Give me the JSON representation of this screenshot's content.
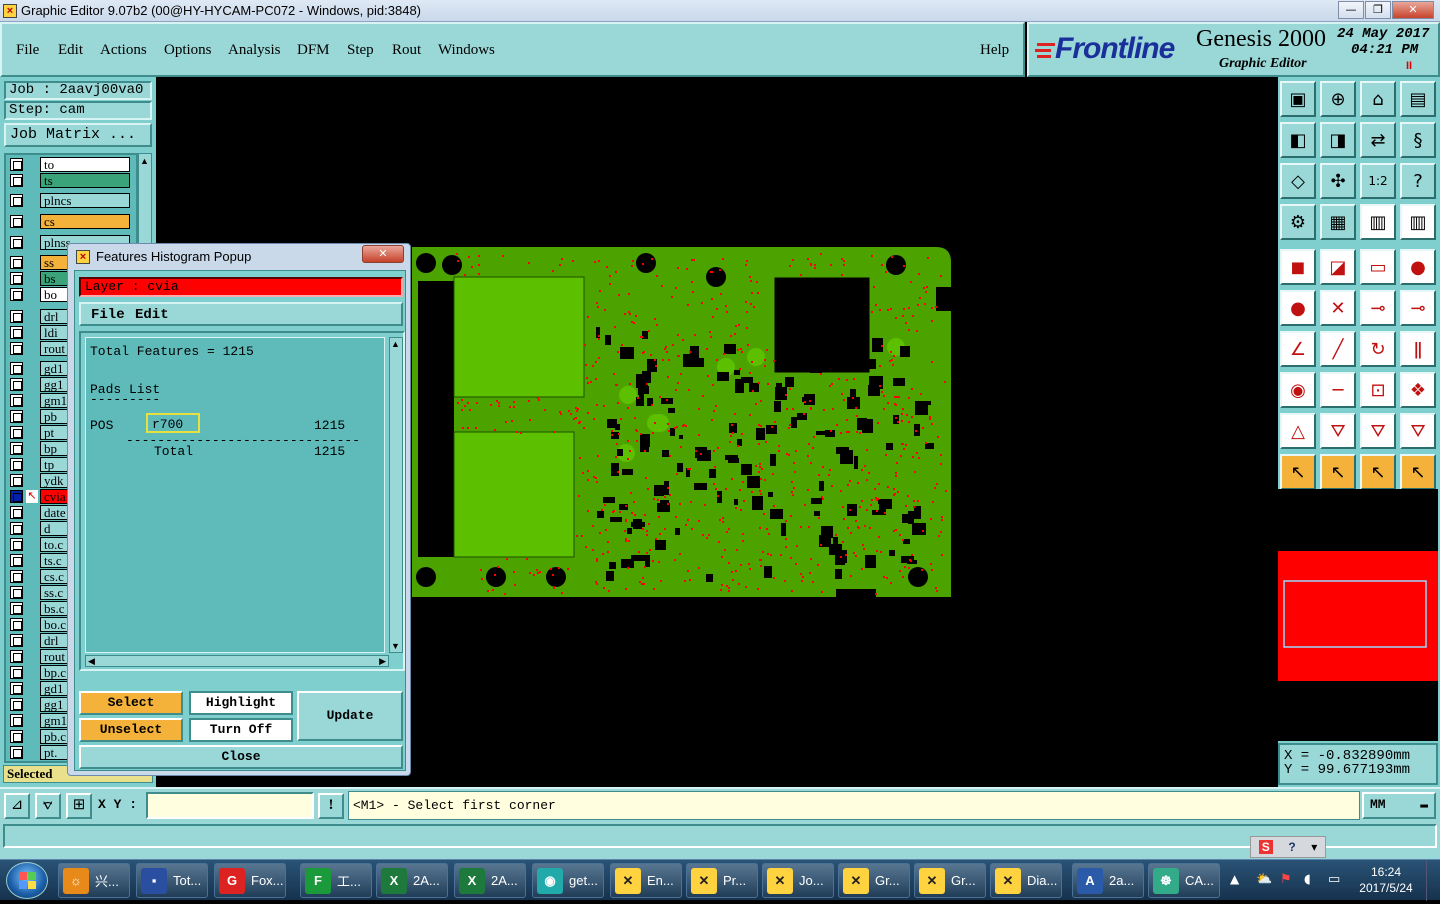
{
  "window": {
    "title": "Graphic Editor 9.07b2 (00@HY-HYCAM-PC072 - Windows, pid:3848)",
    "min": "—",
    "max": "❐",
    "close": "✕"
  },
  "menu": {
    "items": [
      "File",
      "Edit",
      "Actions",
      "Options",
      "Analysis",
      "DFM",
      "Step",
      "Rout",
      "Windows"
    ],
    "help": "Help"
  },
  "brand": {
    "logo": "Frontline",
    "product": "Genesis 2000",
    "subtitle": "Graphic Editor",
    "date": "24 May 2017",
    "time": "04:21 PM",
    "indicator": "II"
  },
  "job": {
    "job_label": "Job : 2aavj00va0",
    "step_label": "Step: cam",
    "matrix_label": "Job Matrix ..."
  },
  "layers": [
    {
      "name": "to",
      "color": "#ffffff"
    },
    {
      "name": "ts",
      "color": "#3aa37a"
    },
    {
      "name": "plncs",
      "color": "#9ad8d8"
    },
    {
      "name": "cs",
      "color": "#f4b23a"
    },
    {
      "name": "plnss",
      "color": "#9ad8d8"
    },
    {
      "name": "ss",
      "color": "#f4b23a"
    },
    {
      "name": "bs",
      "color": "#3aa37a"
    },
    {
      "name": "bo",
      "color": "#ffffff"
    },
    {
      "name": "drl",
      "color": "#9ad8d8"
    },
    {
      "name": "ldi",
      "color": "#9ad8d8"
    },
    {
      "name": "rout",
      "color": "#9ad8d8"
    },
    {
      "name": "gd1",
      "color": "#9ad8d8"
    },
    {
      "name": "gg1",
      "color": "#9ad8d8"
    },
    {
      "name": "gm1",
      "color": "#9ad8d8"
    },
    {
      "name": "pb",
      "color": "#9ad8d8"
    },
    {
      "name": "pt",
      "color": "#9ad8d8"
    },
    {
      "name": "bp",
      "color": "#9ad8d8"
    },
    {
      "name": "tp",
      "color": "#9ad8d8"
    },
    {
      "name": "ydk",
      "color": "#9ad8d8"
    },
    {
      "name": "cvia",
      "color": "#ff0000"
    },
    {
      "name": "date",
      "color": "#9ad8d8"
    },
    {
      "name": "d",
      "color": "#9ad8d8"
    },
    {
      "name": "to.c",
      "color": "#9ad8d8"
    },
    {
      "name": "ts.c",
      "color": "#9ad8d8"
    },
    {
      "name": "cs.c",
      "color": "#9ad8d8"
    },
    {
      "name": "ss.c",
      "color": "#9ad8d8"
    },
    {
      "name": "bs.c",
      "color": "#9ad8d8"
    },
    {
      "name": "bo.c",
      "color": "#9ad8d8"
    },
    {
      "name": "drl",
      "color": "#9ad8d8"
    },
    {
      "name": "rout",
      "color": "#9ad8d8"
    },
    {
      "name": "bp.c",
      "color": "#9ad8d8"
    },
    {
      "name": "gd1",
      "color": "#9ad8d8"
    },
    {
      "name": "gg1",
      "color": "#9ad8d8"
    },
    {
      "name": "gm1",
      "color": "#9ad8d8"
    },
    {
      "name": "pb.c",
      "color": "#9ad8d8"
    },
    {
      "name": "pt.",
      "color": "#9ad8d8"
    }
  ],
  "selected_label": "Selected",
  "popup": {
    "title": "Features Histogram Popup",
    "close": "✕",
    "layer_label": "Layer : cvia",
    "menu": [
      "File",
      "Edit"
    ],
    "total_features": "Total Features = 1215",
    "pads_heading": "Pads List",
    "pads_underline": "---------",
    "row": {
      "polarity": "POS",
      "symbol": "r700",
      "count": "1215"
    },
    "divider": "-------------------------------------",
    "total_label": "Total",
    "total_count": "1215",
    "buttons": {
      "select": "Select",
      "highlight": "Highlight",
      "update": "Update",
      "unselect": "Unselect",
      "turn_off": "Turn Off",
      "close": "Close"
    }
  },
  "coords": {
    "x": "X = -0.832890mm",
    "y": "Y = 99.677193mm"
  },
  "status": {
    "xy_label": "X Y :",
    "xy_value": "",
    "message": "<M1> - Select first corner",
    "units": "MM"
  },
  "taskbar": {
    "items": [
      {
        "label": "兴...",
        "icon": "shell-icon"
      },
      {
        "label": "Tot...",
        "icon": "floppy-icon"
      },
      {
        "label": "Fox...",
        "icon": "foxit-icon"
      },
      {
        "label": "工...",
        "icon": "f-app-icon"
      },
      {
        "label": "2A...",
        "icon": "excel-icon"
      },
      {
        "label": "2A...",
        "icon": "excel-icon"
      },
      {
        "label": "get...",
        "icon": "eye-icon"
      },
      {
        "label": "En...",
        "icon": "genesis-icon"
      },
      {
        "label": "Pr...",
        "icon": "genesis-icon"
      },
      {
        "label": "Jo...",
        "icon": "genesis-icon"
      },
      {
        "label": "Gr...",
        "icon": "genesis-icon"
      },
      {
        "label": "Gr...",
        "icon": "genesis-icon"
      },
      {
        "label": "Dia...",
        "icon": "genesis-icon"
      },
      {
        "label": "2a...",
        "icon": "word-icon"
      },
      {
        "label": "CA...",
        "icon": "cam-icon"
      }
    ],
    "clock_time": "16:24",
    "clock_date": "2017/5/24"
  },
  "colors": {
    "panel": "#7fcfcf",
    "board": "#4ca300",
    "via": "#ff0000",
    "highlight": "#f4b23a"
  }
}
